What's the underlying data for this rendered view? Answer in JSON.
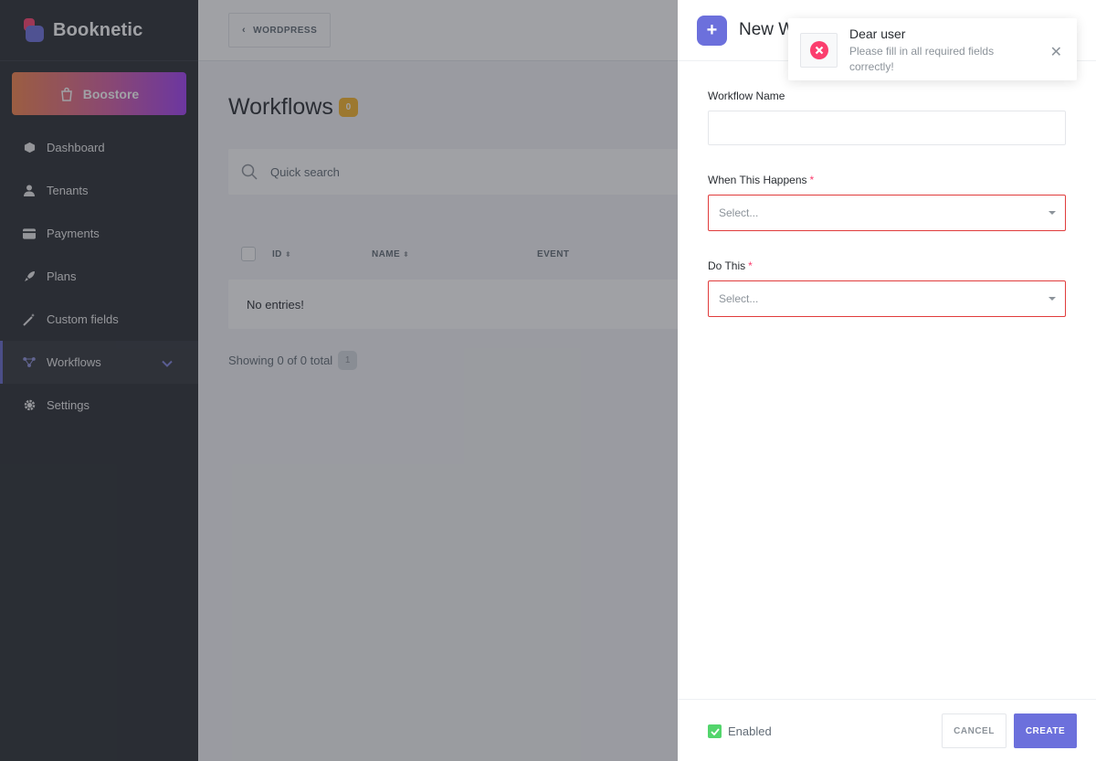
{
  "brand": {
    "name": "Booknetic"
  },
  "sidebar": {
    "boostore_label": "Boostore",
    "items": [
      {
        "label": "Dashboard",
        "icon": "cube-icon"
      },
      {
        "label": "Tenants",
        "icon": "user-icon"
      },
      {
        "label": "Payments",
        "icon": "credit-card-icon"
      },
      {
        "label": "Plans",
        "icon": "rocket-icon"
      },
      {
        "label": "Custom fields",
        "icon": "magic-wand-icon"
      },
      {
        "label": "Workflows",
        "icon": "workflow-icon",
        "active": true
      },
      {
        "label": "Settings",
        "icon": "gear-icon"
      }
    ]
  },
  "topbar": {
    "wordpress_label": "WORDPRESS"
  },
  "page": {
    "title": "Workflows",
    "count": "0",
    "search_placeholder": "Quick search",
    "columns": [
      "ID",
      "NAME",
      "EVENT"
    ],
    "empty_text": "No entries!",
    "showing_text": "Showing 0 of 0 total",
    "page_number": "1"
  },
  "panel": {
    "title": "New Workflow",
    "fields": {
      "workflow_name_label": "Workflow Name",
      "workflow_name_value": "",
      "when_label": "When This Happens",
      "when_placeholder": "Select...",
      "do_label": "Do This",
      "do_placeholder": "Select..."
    },
    "required_mark": "*",
    "footer": {
      "enabled_label": "Enabled",
      "cancel_label": "CANCEL",
      "create_label": "CREATE"
    }
  },
  "toast": {
    "title": "Dear user",
    "message": "Please fill in all required fields correctly!"
  },
  "colors": {
    "accent": "#6c70dc",
    "error": "#e03c3c",
    "sidebar_bg": "#292d32",
    "badge": "#f7b529",
    "success": "#53d56c"
  }
}
